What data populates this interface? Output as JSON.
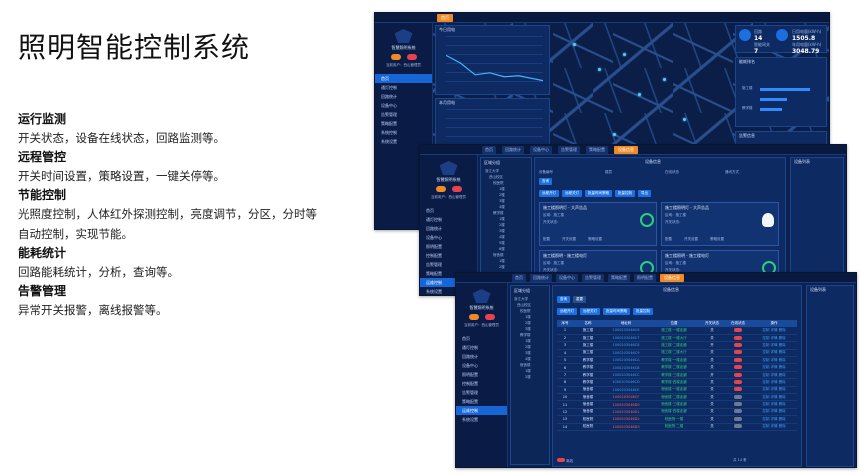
{
  "page": {
    "title": "照明智能控制系统"
  },
  "features": [
    {
      "heading": "运行监测",
      "desc": "开关状态，设备在线状态，回路监测等。"
    },
    {
      "heading": "远程管控",
      "desc": "开关时间设置，策略设置，一键关停等。"
    },
    {
      "heading": "节能控制",
      "desc": "光照度控制，人体红外探测控制，亮度调节，分区，分时等自动控制，实现节能。"
    },
    {
      "heading": "能耗统计",
      "desc": "回路能耗统计，分析，查询等。"
    },
    {
      "heading": "告警管理",
      "desc": "异常开关报警，离线报警等。"
    }
  ],
  "shot1": {
    "sysname": "智慧照明系统",
    "user": "当前用户：西山管理员",
    "menu": [
      "首页",
      "通灯控制",
      "回路统计",
      "设备中心",
      "告警管理",
      "策略配置",
      "系统控制",
      "系统设置"
    ],
    "line_chart_title": "今日用电",
    "line_chart_title2": "本月用电",
    "stats": [
      {
        "label": "回路",
        "value": "14"
      },
      {
        "label": "智能网关",
        "value": "7"
      },
      {
        "label": "日用电量(kW·h)",
        "value": "1505.8"
      },
      {
        "label": "年用电量(kW·h)",
        "value": "3048.79"
      }
    ],
    "rank_title": "能耗排名",
    "rank_rows": [
      {
        "label": "施工楼",
        "ratio": 0.78
      },
      {
        "label": "",
        "ratio": 0.42
      },
      {
        "label": "教学楼",
        "ratio": 0.34
      }
    ],
    "alarm_title": "告警信息"
  },
  "shot2": {
    "tree_title": "区域分组",
    "tree_nodes": [
      "浙江大学",
      "西山校区",
      "校医院",
      "1楼",
      "2楼",
      "3楼",
      "4楼",
      "教学楼",
      "1楼",
      "2楼",
      "3楼",
      "4楼",
      "5楼",
      "6楼",
      "宿舍楼",
      "1楼",
      "2楼"
    ],
    "header": "设备信息",
    "right_title": "设备列表",
    "filter_label1": "设备编号",
    "filter_label2": "楼层",
    "filter_label3": "在线状态",
    "filter_label4": "通讯方式",
    "buttons": [
      "查询",
      "远程开灯",
      "远程关灯",
      "批量时间策略",
      "批量控制",
      "导出"
    ],
    "cards": [
      {
        "title": "施工楼照明灯 - 大声告品",
        "line1": "区域：施工楼",
        "line2": "开关状态："
      },
      {
        "title": "施工楼照明灯 - 大声告品",
        "line1": "区域：施工楼",
        "line2": "开关状态："
      },
      {
        "title": "施工楼照明 - 施工楼电灯",
        "line1": "区域：施工楼",
        "line2": "开关状态："
      },
      {
        "title": "施工楼照明 - 施工楼电灯",
        "line1": "区域：施工楼",
        "line2": "开关状态："
      }
    ],
    "card_actions": [
      "配置",
      "开关设置",
      "策略设置"
    ],
    "menu": [
      "首页",
      "通灯控制",
      "回路统计",
      "设备中心",
      "照明配置",
      "控制配置",
      "告警管理",
      "策略配置",
      "运维控制",
      "系统设置"
    ]
  },
  "shot3": {
    "tabs": [
      "首页",
      "回路统计",
      "设备中心",
      "告警管理",
      "策略配置",
      "照明配置",
      "运维控制",
      "设备管理"
    ],
    "active_tab": "设备信息",
    "header": "设备信息",
    "right_title": "设备列表",
    "tree_title": "区域分组",
    "columns": [
      "序号",
      "名称",
      "地址码",
      "位置",
      "开关状态",
      "在线状态",
      "操作"
    ],
    "rows": [
      {
        "no": "1",
        "name": "施工楼",
        "addr": "1000203046C6",
        "loc": "施工楼·一楼走廊",
        "sw": "关",
        "online": "on"
      },
      {
        "no": "2",
        "name": "施工楼",
        "addr": "1000203046C7",
        "loc": "施工楼·一楼大厅",
        "sw": "关",
        "online": "on"
      },
      {
        "no": "3",
        "name": "施工楼",
        "addr": "1000203046C8",
        "loc": "施工楼·二楼走廊",
        "sw": "开",
        "online": "on"
      },
      {
        "no": "4",
        "name": "施工楼",
        "addr": "1000203046C9",
        "loc": "施工楼·二楼大厅",
        "sw": "关",
        "online": "on"
      },
      {
        "no": "5",
        "name": "教学楼",
        "addr": "1000203046CA",
        "loc": "教学楼·一楼走廊",
        "sw": "关",
        "online": "on"
      },
      {
        "no": "6",
        "name": "教学楼",
        "addr": "1000203046CB",
        "loc": "教学楼·二楼走廊",
        "sw": "关",
        "online": "on"
      },
      {
        "no": "7",
        "name": "教学楼",
        "addr": "1000203046CC",
        "loc": "教学楼·三楼走廊",
        "sw": "开",
        "online": "on"
      },
      {
        "no": "8",
        "name": "教学楼",
        "addr": "1000203046CD",
        "loc": "教学楼·四楼走廊",
        "sw": "关",
        "online": "on"
      },
      {
        "no": "9",
        "name": "宿舍楼",
        "addr": "1000203046CE",
        "loc": "宿舍楼·一楼走廊",
        "sw": "关",
        "online": "on"
      },
      {
        "no": "10",
        "name": "宿舍楼",
        "addr": "1000203046CF",
        "loc": "宿舍楼·二楼走廊",
        "sw": "关",
        "online": "off"
      },
      {
        "no": "11",
        "name": "宿舍楼",
        "addr": "1000203046D0",
        "loc": "宿舍楼·三楼走廊",
        "sw": "关",
        "online": "off"
      },
      {
        "no": "12",
        "name": "宿舍楼",
        "addr": "1000203046D1",
        "loc": "宿舍楼·四楼走廊",
        "sw": "关",
        "online": "off"
      },
      {
        "no": "13",
        "name": "校医院",
        "addr": "1000203046D2",
        "loc": "校医院·一楼",
        "sw": "关",
        "online": "off"
      },
      {
        "no": "14",
        "name": "校医院",
        "addr": "1000203046D3",
        "loc": "校医院·二楼",
        "sw": "关",
        "online": "off"
      }
    ],
    "row_action": "控制 详情 删除",
    "pager": "共 14 条",
    "footer_status": "离线",
    "buttons": [
      "查询",
      "重置",
      "远程开灯",
      "远程关灯",
      "批量时间策略",
      "批量控制"
    ]
  }
}
